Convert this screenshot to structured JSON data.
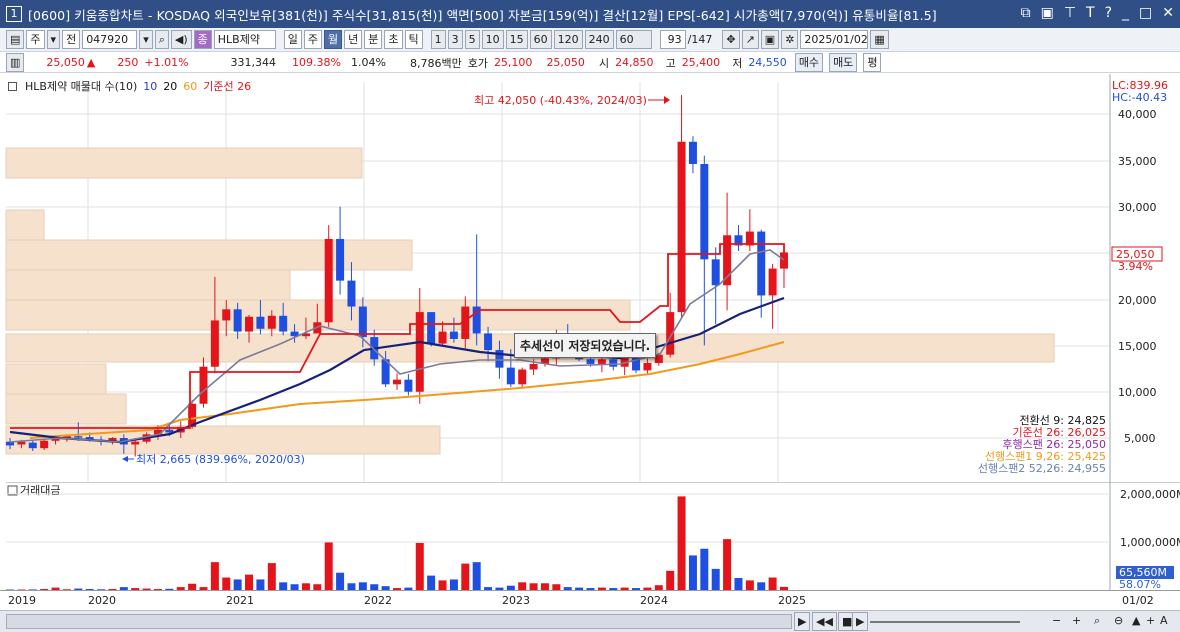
{
  "window": {
    "screen_number": "1",
    "title": "[0600] 키움종합차트 - KOSDAQ 외국인보유[381(천)] 주식수[31,815(천)] 액면[500] 자본금[159(억)] 결산[12월] EPS[-642] 시가총액[7,970(억)] 유통비율[81.5]"
  },
  "toolbar": {
    "mode": "주",
    "type": "전",
    "code": "047920",
    "name_prefix": "종",
    "name": "HLB제약",
    "periods": [
      "일",
      "주",
      "월",
      "년",
      "분",
      "초",
      "틱"
    ],
    "selected_period": "월",
    "intervals": [
      "1",
      "3",
      "5",
      "10",
      "15",
      "60",
      "120",
      "240"
    ],
    "interval_input": "60",
    "count": "93",
    "total": "/147",
    "date": "2025/01/02"
  },
  "quote": {
    "price": "25,050",
    "arrow": "▲",
    "change": "250",
    "change_pct": "+1.01%",
    "volume": "331,344",
    "vol_ratio": "109.38%",
    "turnover": "1.04%",
    "amount": "8,786백만",
    "bid_label": "호가",
    "ask": "25,100",
    "bid": "25,050",
    "open_label": "시",
    "open": "24,850",
    "high_label": "고",
    "high": "25,400",
    "low_label": "저",
    "low": "24,550",
    "buy": "매수",
    "sell": "매도",
    "eval": "평"
  },
  "legend": {
    "main": "HLB제약 매물대 수(10)",
    "ma10": "10",
    "ma20": "20",
    "ma60": "60",
    "base": "기준선 26"
  },
  "price_axis": {
    "lc": "LC:839.96",
    "hc": "HC:-40.43",
    "ticks": [
      "40,000",
      "35,000",
      "30,000",
      "25,000",
      "20,000",
      "15,000",
      "10,000",
      "5,000"
    ],
    "current": "25,050",
    "current_pct": "3.94%"
  },
  "annotations": {
    "high": "최고 42,050 (-40.43%, 2024/03)",
    "low": "최저 2,665 (839.96%, 2020/03)",
    "toast": "추세선이 저장되었습니다."
  },
  "ichimoku": [
    {
      "label": "전환선 9: 24,825",
      "color": "#111111"
    },
    {
      "label": "기준선 26: 26,025",
      "color": "#e4141b"
    },
    {
      "label": "후행스팬 26: 25,050",
      "color": "#8e2aa8"
    },
    {
      "label": "선행스팬1 9,26: 25,425",
      "color": "#f29a1c"
    },
    {
      "label": "선행스팬2 52,26: 24,955",
      "color": "#6b7fb0"
    }
  ],
  "volume_panel": {
    "title": "거래대금",
    "ticks": [
      "2,000,000M",
      "1,000,000M"
    ],
    "current": "65,560M",
    "current_pct": "58.07%"
  },
  "x_axis": {
    "labels": [
      "2019",
      "2020",
      "2021",
      "2022",
      "2023",
      "2024",
      "2025"
    ],
    "right_label": "01/02"
  },
  "colors": {
    "up": "#e4141b",
    "down": "#1f4fe0",
    "title_bar": "#2f4f86",
    "volume_profile": "#f5e1cc"
  }
}
